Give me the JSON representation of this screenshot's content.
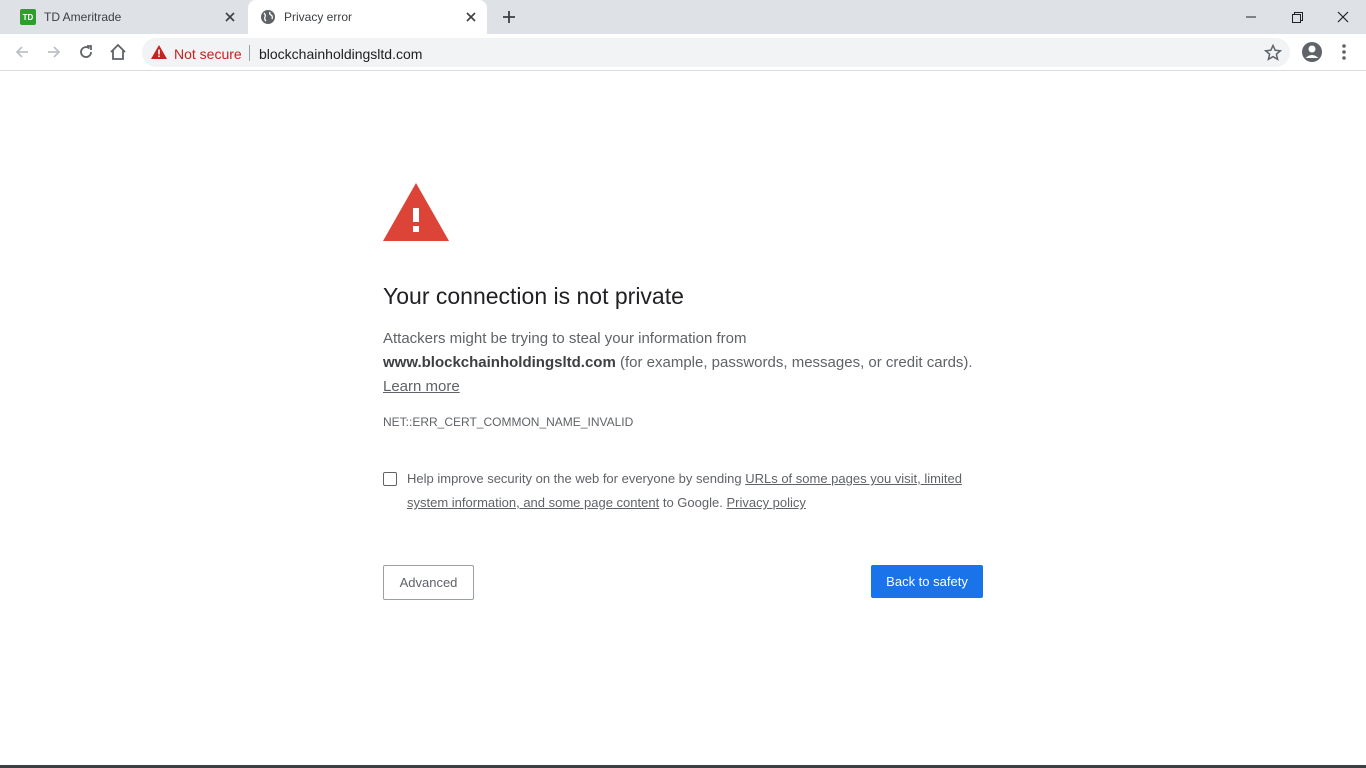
{
  "tabs": [
    {
      "title": "TD Ameritrade",
      "favicon": "td-logo",
      "favicon_text": "TD",
      "active": false
    },
    {
      "title": "Privacy error",
      "favicon": "globe-icon",
      "active": true
    }
  ],
  "toolbar": {
    "security_label": "Not secure",
    "url": "blockchainholdingsltd.com"
  },
  "interstitial": {
    "heading": "Your connection is not private",
    "explanation_prefix": "Attackers might be trying to steal your information from",
    "domain": "www.blockchainholdingsltd.com",
    "explanation_suffix": "(for example, passwords, messages, or credit cards).",
    "learn_more": "Learn more",
    "error_code": "NET::ERR_CERT_COMMON_NAME_INVALID",
    "optin_prefix": "Help improve security on the web for everyone by sending",
    "optin_link": "URLs of some pages you visit, limited system information, and some page content",
    "optin_middle": "to Google.",
    "privacy_policy": "Privacy policy",
    "advanced_button": "Advanced",
    "back_button": "Back to safety"
  },
  "colors": {
    "accent": "#1a73e8",
    "danger": "#c5221f",
    "alert_icon": "#db4437",
    "tabstrip": "#dee1e6"
  }
}
